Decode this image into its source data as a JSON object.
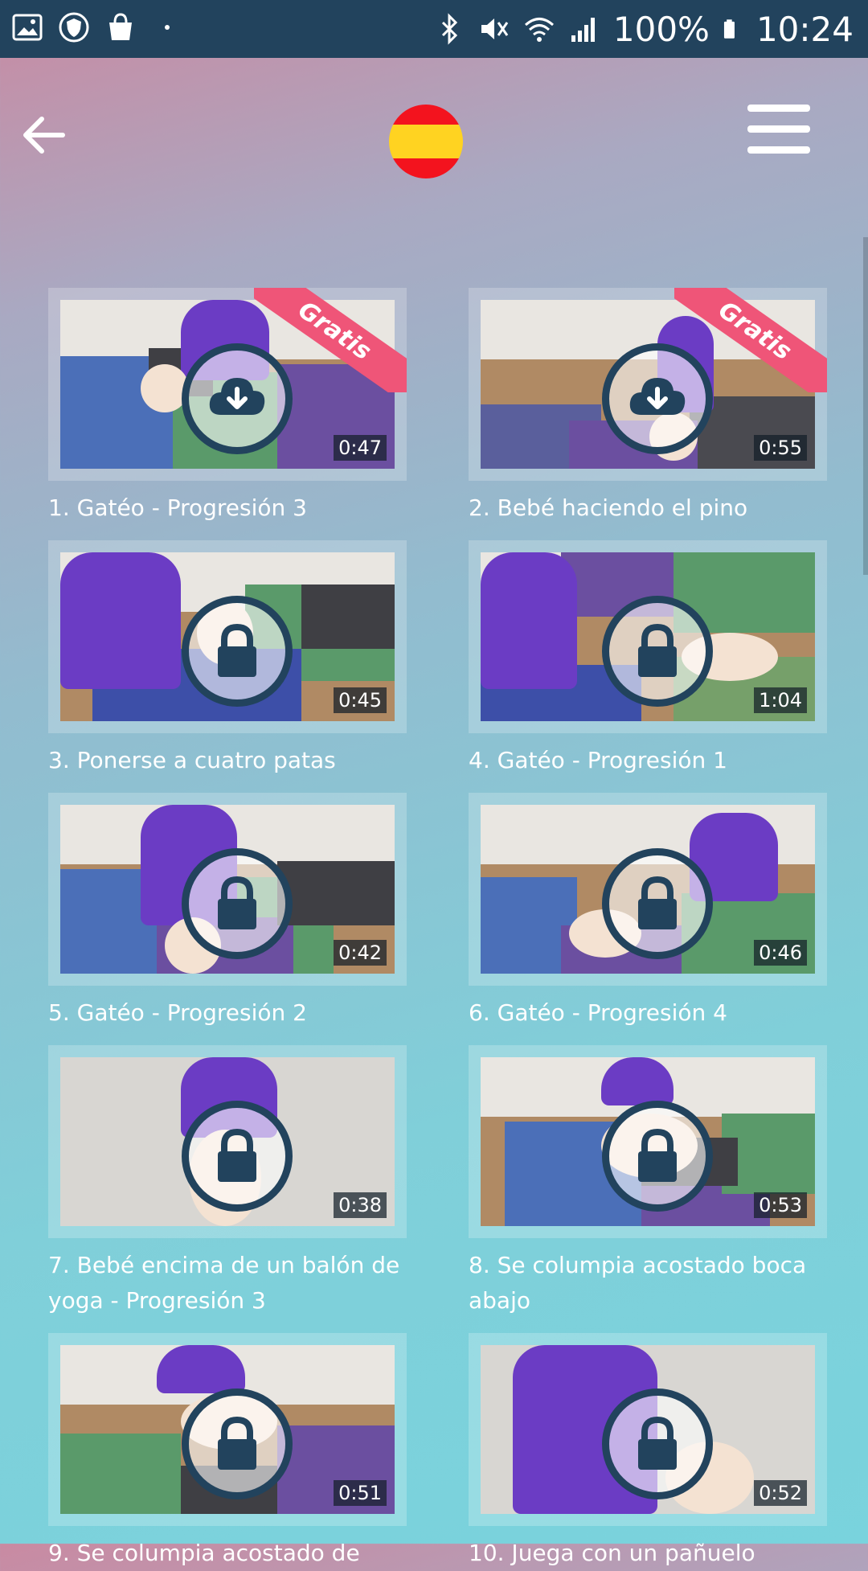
{
  "statusbar": {
    "battery": "100%",
    "time": "10:24",
    "icons_left": [
      "image-icon",
      "shield-icon",
      "shopping-bag-icon",
      "dot-icon"
    ],
    "icons_right": [
      "bluetooth-icon",
      "mute-icon",
      "wifi-icon",
      "signal-icon",
      "battery-icon"
    ]
  },
  "header": {
    "back_icon": "arrow-left-icon",
    "language_flag": "spain-flag",
    "menu_icon": "hamburger-menu-icon"
  },
  "videos": [
    {
      "title": "1. Gatéo - Progresión 3",
      "duration": "0:47",
      "status": "download",
      "badge": "Gratis"
    },
    {
      "title": "2. Bebé haciendo el pino",
      "duration": "0:55",
      "status": "download",
      "badge": "Gratis"
    },
    {
      "title": "3. Ponerse a cuatro patas",
      "duration": "0:45",
      "status": "locked",
      "badge": ""
    },
    {
      "title": "4. Gatéo - Progresión 1",
      "duration": "1:04",
      "status": "locked",
      "badge": ""
    },
    {
      "title": "5. Gatéo - Progresión 2",
      "duration": "0:42",
      "status": "locked",
      "badge": ""
    },
    {
      "title": "6. Gatéo - Progresión 4",
      "duration": "0:46",
      "status": "locked",
      "badge": ""
    },
    {
      "title": "7. Bebé encima de un balón de yoga - Progresión 3",
      "duration": "0:38",
      "status": "locked",
      "badge": ""
    },
    {
      "title": "8. Se columpia acostado boca abajo",
      "duration": "0:53",
      "status": "locked",
      "badge": ""
    },
    {
      "title": "9. Se columpia acostado de",
      "duration": "0:51",
      "status": "locked",
      "badge": ""
    },
    {
      "title": "10. Juega con un pañuelo",
      "duration": "0:52",
      "status": "locked",
      "badge": ""
    }
  ],
  "colors": {
    "statusbar": "#22435d",
    "badge": "#ef5578",
    "icon_ring": "#22435d"
  }
}
